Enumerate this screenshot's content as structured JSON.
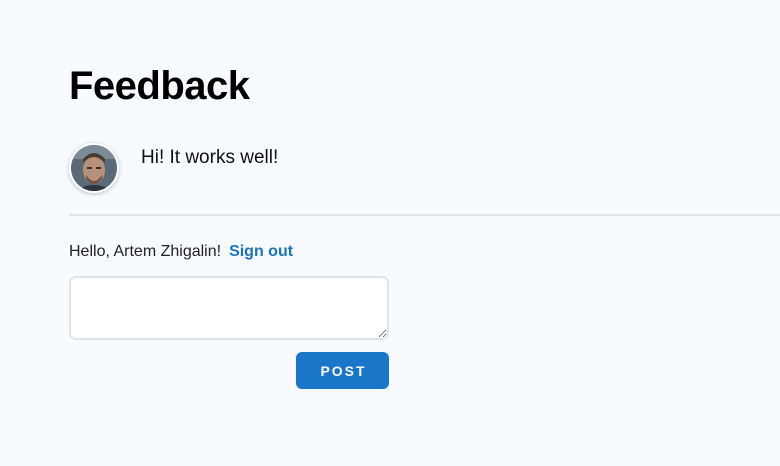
{
  "page": {
    "title": "Feedback"
  },
  "comments": [
    {
      "avatar_icon": "user-avatar-photo",
      "text": "Hi! It works well!"
    }
  ],
  "session": {
    "greeting": "Hello, Artem Zhigalin!",
    "sign_out_label": "Sign out"
  },
  "form": {
    "input_value": "",
    "post_label": "POST"
  },
  "colors": {
    "background": "#f7faff",
    "accent": "#1a76c9",
    "link": "#1a73c4",
    "divider": "#dfe4ea"
  }
}
